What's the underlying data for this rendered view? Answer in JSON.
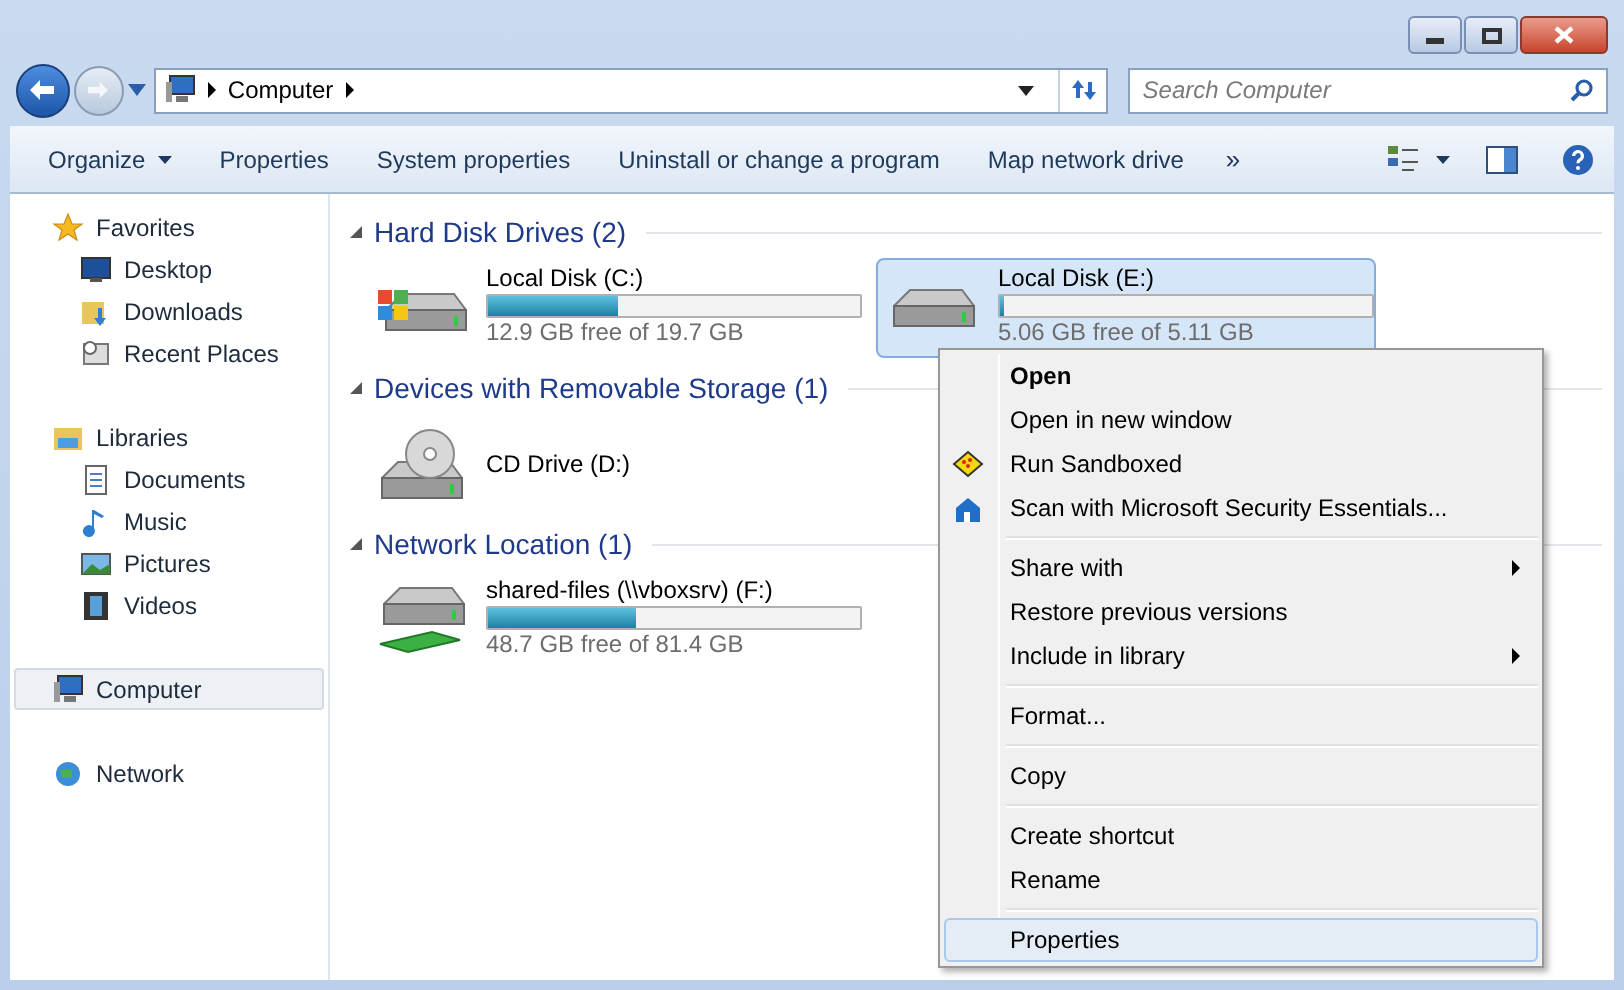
{
  "window": {
    "buttons": [
      {
        "kind": "minimize"
      },
      {
        "kind": "maximize"
      },
      {
        "kind": "close"
      }
    ]
  },
  "address_bar": {
    "path": "Computer"
  },
  "search": {
    "placeholder": "Search Computer"
  },
  "toolbar": {
    "items": [
      "Organize",
      "Properties",
      "System properties",
      "Uninstall or change a program",
      "Map network drive"
    ],
    "more": "»"
  },
  "sidebar": {
    "groups": [
      {
        "label": "Favorites",
        "selected": false,
        "children": [
          {
            "label": "Desktop",
            "selected": false
          },
          {
            "label": "Downloads",
            "selected": false
          },
          {
            "label": "Recent Places",
            "selected": false
          }
        ]
      },
      {
        "label": "Libraries",
        "selected": false,
        "children": [
          {
            "label": "Documents",
            "selected": false
          },
          {
            "label": "Music",
            "selected": false
          },
          {
            "label": "Pictures",
            "selected": false
          },
          {
            "label": "Videos",
            "selected": false
          }
        ]
      },
      {
        "label": "Computer",
        "selected": true
      },
      {
        "label": "Network",
        "selected": false
      }
    ]
  },
  "groups": [
    {
      "title": "Hard Disk Drives (2)",
      "expanded": true,
      "items": [
        {
          "name": "Local Disk (C:)",
          "kind": "windows",
          "level": 0.35,
          "free": "12.9 GB free of 19.7 GB",
          "selected": false
        },
        {
          "name": "Local Disk (E:)",
          "kind": "disk",
          "level": 0.01,
          "free": "5.06 GB free of 5.11 GB",
          "selected": true
        }
      ]
    },
    {
      "title": "Devices with Removable Storage (1)",
      "expanded": true,
      "items": [
        {
          "name": "CD Drive (D:)",
          "kind": "cd",
          "selected": false
        }
      ]
    },
    {
      "title": "Network Location (1)",
      "expanded": true,
      "items": [
        {
          "name": "shared-files (\\\\vboxsrv) (F:)",
          "kind": "network",
          "level": 0.4,
          "free": "48.7 GB free of 81.4 GB",
          "selected": false
        }
      ]
    }
  ],
  "context_menu": {
    "sections": [
      [
        {
          "label": "Open",
          "bold": true,
          "selected": false
        },
        {
          "label": "Open in new window",
          "selected": false
        },
        {
          "label": "Run Sandboxed",
          "selected": false
        },
        {
          "label": "Scan with Microsoft Security Essentials...",
          "selected": false
        }
      ],
      [
        {
          "label": "Share with",
          "submenu": true,
          "selected": false
        },
        {
          "label": "Restore previous versions",
          "selected": false
        },
        {
          "label": "Include in library",
          "submenu": true,
          "selected": false
        }
      ],
      [
        {
          "label": "Format...",
          "selected": false
        }
      ],
      [
        {
          "label": "Copy",
          "selected": false
        }
      ],
      [
        {
          "label": "Create shortcut",
          "selected": false
        },
        {
          "label": "Rename",
          "selected": false
        }
      ],
      [
        {
          "label": "Properties",
          "selected": true
        }
      ]
    ]
  }
}
